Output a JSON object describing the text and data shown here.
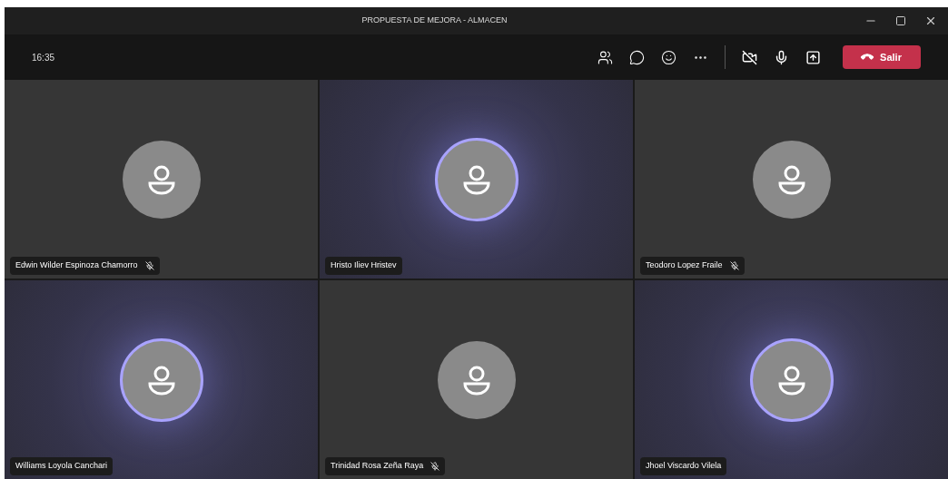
{
  "window": {
    "title": "PROPUESTA DE MEJORA - ALMACEN"
  },
  "toolbar": {
    "time": "16:35",
    "leave_button": "Salir"
  },
  "participants": [
    {
      "name": "Edwin Wilder Espinoza Chamorro",
      "muted": true,
      "speaking": false
    },
    {
      "name": "Hristo Iliev Hristev",
      "muted": false,
      "speaking": true
    },
    {
      "name": "Teodoro Lopez Fraile",
      "muted": true,
      "speaking": false
    },
    {
      "name": "Williams Loyola Canchari",
      "muted": false,
      "speaking": true
    },
    {
      "name": "Trinidad Rosa Zeña Raya",
      "muted": true,
      "speaking": false
    },
    {
      "name": "Jhoel Viscardo Vilela",
      "muted": false,
      "speaking": true
    }
  ]
}
